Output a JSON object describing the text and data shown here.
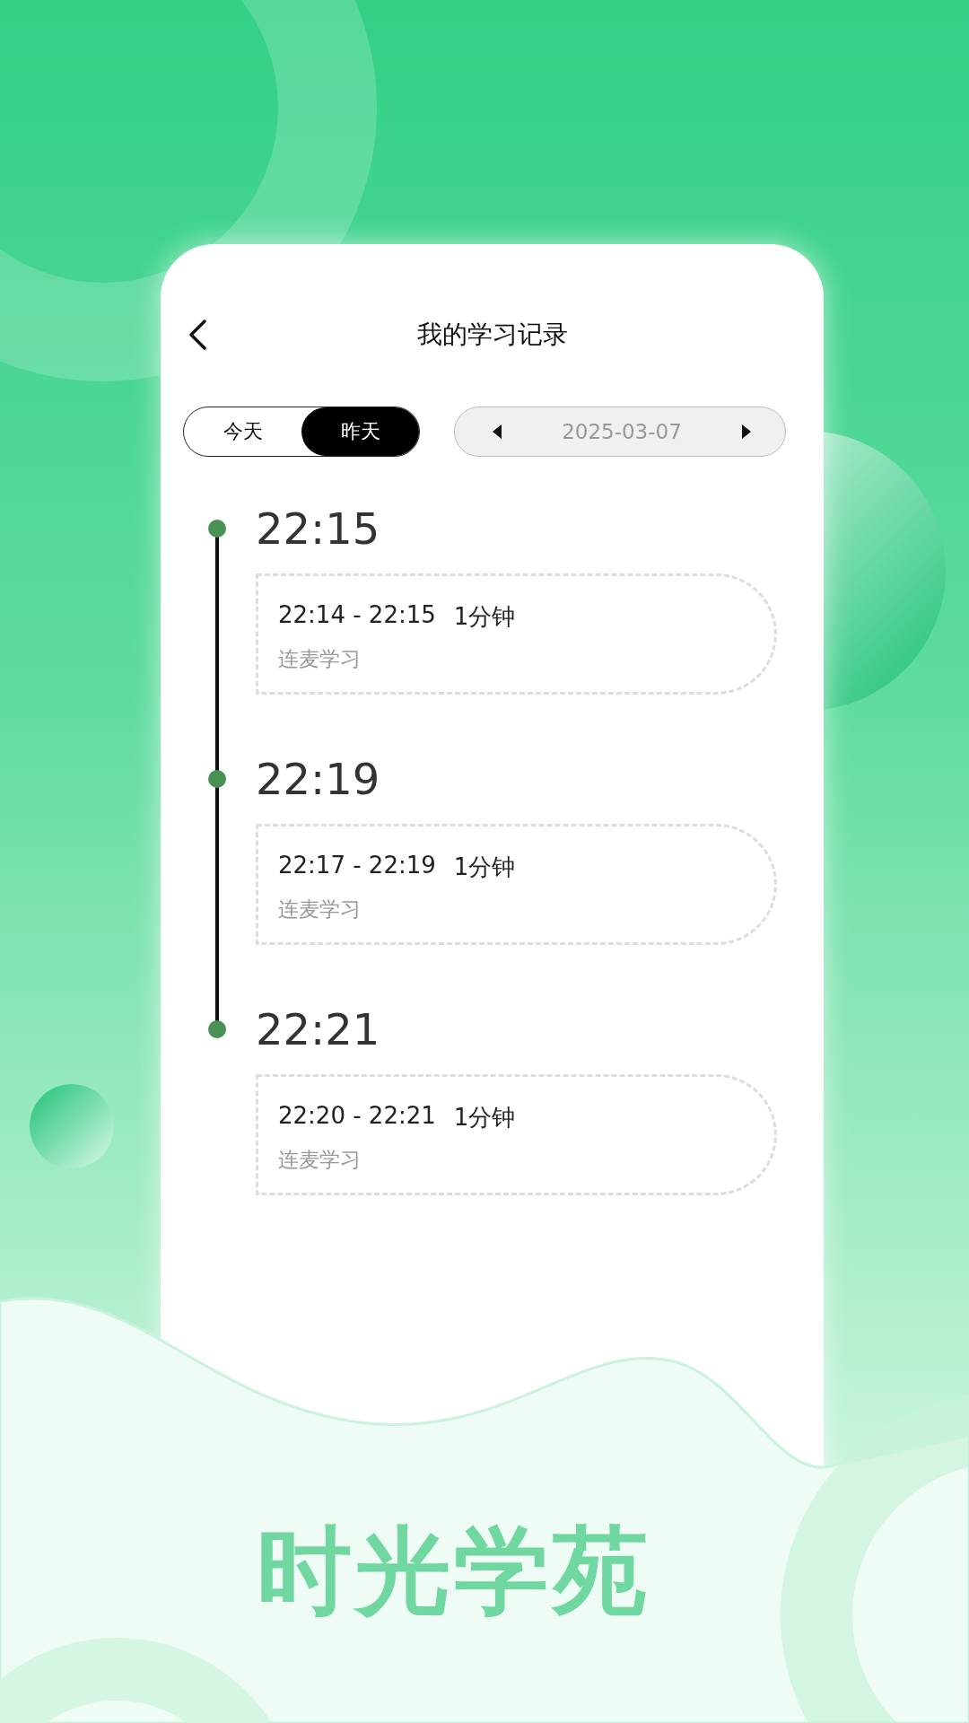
{
  "header": {
    "title": "我的学习记录"
  },
  "day_tabs": [
    {
      "label": "今天",
      "selected": false
    },
    {
      "label": "昨天",
      "selected": true
    }
  ],
  "date_picker": {
    "value": "2025-03-07"
  },
  "records": [
    {
      "time": "22:15",
      "range": "22:14 - 22:15",
      "duration": "1分钟",
      "activity": "连麦学习"
    },
    {
      "time": "22:19",
      "range": "22:17 - 22:19",
      "duration": "1分钟",
      "activity": "连麦学习"
    },
    {
      "time": "22:21",
      "range": "22:20 - 22:21",
      "duration": "1分钟",
      "activity": "连麦学习"
    }
  ],
  "brand": "时光学苑"
}
